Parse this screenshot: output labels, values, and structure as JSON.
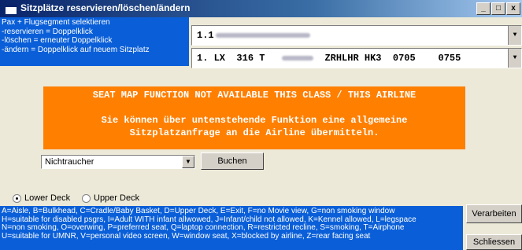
{
  "window": {
    "title": "Sitzplätze reservieren/löschen/ändern",
    "min_label": "_",
    "max_label": "□",
    "close_label": "x"
  },
  "info": {
    "lines": [
      "Pax + Flugsegment selektieren",
      "-reservieren = Doppelklick",
      "-löschen = erneuter Doppelklick",
      "-ändern = Doppelklick auf neuem Sitzplatz"
    ]
  },
  "passenger": {
    "value": "1.1"
  },
  "segment": {
    "num": "1.",
    "airline": "LX",
    "flight": "316",
    "class": "T",
    "route": "ZRHLHR",
    "status": "HK3",
    "dep": "0705",
    "arr": "0755"
  },
  "notice": {
    "line1": "SEAT MAP FUNCTION NOT AVAILABLE THIS CLASS / THIS AIRLINE",
    "line2": "Sie können über untenstehende Funktion eine allgemeine",
    "line3": "Sitzplatzanfrage an die Airline übermitteln."
  },
  "seat_pref": {
    "selected": "Nichtraucher"
  },
  "buttons": {
    "buchen": "Buchen",
    "verarbeiten": "Verarbeiten",
    "schliessen": "Schliessen"
  },
  "deck": {
    "lower": "Lower Deck",
    "upper": "Upper Deck",
    "selected": "lower"
  },
  "legend": {
    "lines": [
      "A=Aisle, B=Bulkhead, C=Cradle/Baby Basket, D=Upper Deck, E=Exit, F=no Movie view, G=non smoking window",
      "H=suitable for disabled psgrs, I=Adult WITH infant allwowed, J=Infant/child not allowed, K=Kennel allowed, L=legspace",
      "N=non smoking, O=overwing, P=preferred seat, Q=laptop connection, R=restricted recline, S=smoking, T=Airphone",
      "U=suitable for UMNR, V=personal video screen, W=window seat, X=blocked by airline, Z=rear facing seat"
    ]
  },
  "icons": {
    "dropdown": "▼"
  },
  "colors": {
    "titlebar": "#0a246a",
    "infobox": "#0a5fd8",
    "notice": "#ff7f00",
    "dialog": "#ece9d8"
  }
}
